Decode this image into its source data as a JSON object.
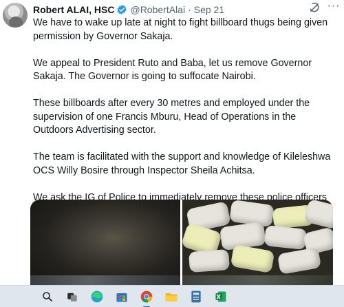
{
  "tweet": {
    "author_name": "Robert ALAI, HSC",
    "handle": "@RobertAlai",
    "separator": "·",
    "date": "Sep 21",
    "more_label": "···",
    "paragraphs": [
      "We have to wake up late at night to fight billboard thugs being given permission by Governor Sakaja.",
      "We appeal to President Ruto and Baba, let us remove Governor Sakaja. The Governor is going to suffocate Nairobi.",
      "These billboards after every 30 metres and employed under the supervision of one Francis Mburu, Head of Operations in the Outdoors Advertising sector.",
      "The team is facilitated with the support and knowledge of Kileleshwa OCS Willy Bosire through Inspector Sheila Achitsa.",
      "We ask the IG of Police to immediately remove these police officers from the area as they have become a cartel of chaos and disorder in our midst."
    ],
    "verified_color": "#1d9bf0"
  },
  "taskbar": {
    "icons": [
      "search-icon",
      "task-view-icon",
      "edge-icon",
      "store-icon",
      "chrome-icon",
      "file-explorer-icon",
      "calculator-icon",
      "excel-icon"
    ],
    "accent": "#0067c0"
  }
}
